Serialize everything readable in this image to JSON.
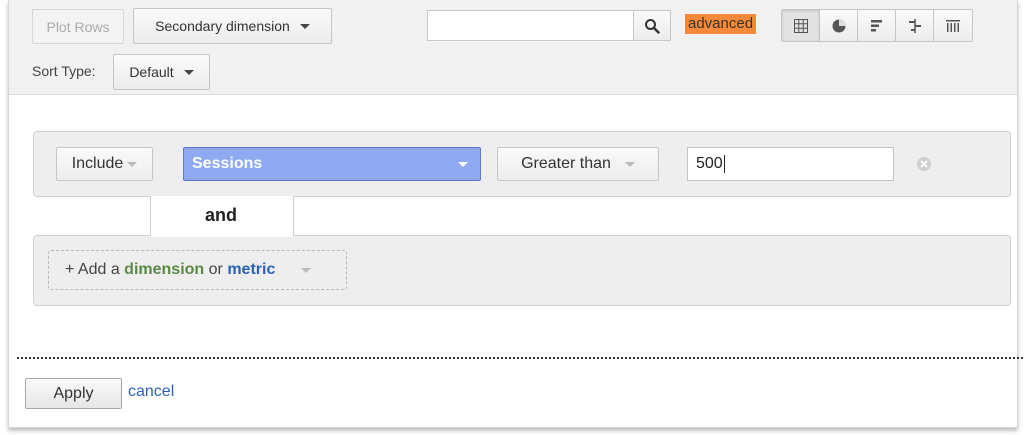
{
  "toolbar": {
    "plot_rows_label": "Plot Rows",
    "secondary_dimension_label": "Secondary dimension",
    "search_value": "",
    "advanced_label": "advanced",
    "sort_type_label": "Sort Type:",
    "sort_type_value": "Default",
    "view_buttons": [
      "table-view",
      "pie-view",
      "performance-view",
      "comparison-view",
      "pivot-view"
    ]
  },
  "filter": {
    "include_label": "Include",
    "metric_value": "Sessions",
    "operator_value": "Greater than",
    "input_value": "500",
    "and_label": "and"
  },
  "add_condition": {
    "prefix": "+ Add a",
    "dimension_word": "dimension",
    "or_word": "or",
    "metric_word": "metric"
  },
  "footer": {
    "apply_label": "Apply",
    "cancel_label": "cancel"
  },
  "colors": {
    "advanced_highlight": "#f68a3a",
    "metric_select_bg": "#8fa9f2",
    "dimension_text": "#5a8a46",
    "metric_text": "#2a62b8"
  }
}
